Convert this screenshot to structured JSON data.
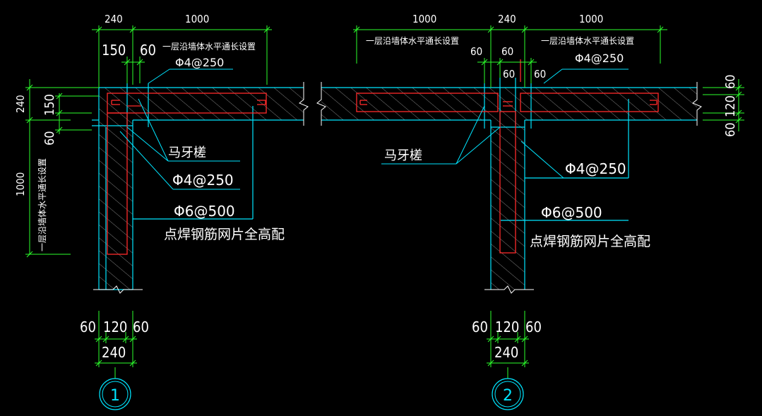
{
  "colors": {
    "background": "#000000",
    "wall_outline": "#00e5ff",
    "rebar": "#ff2a2a",
    "dimension": "#2cff2c",
    "text": "#ffffff",
    "hatch": "#a0a0a0"
  },
  "detail_1": {
    "number": "1",
    "dims_top": {
      "d240": "240",
      "d1000": "1000",
      "d150": "150",
      "d60": "60"
    },
    "note_top": "一层沿墙体水平通长设置",
    "rebar_top": "Φ4@250",
    "dims_left": {
      "d240": "240",
      "d150": "150",
      "d60": "60",
      "d1000": "1000"
    },
    "note_left": "一层沿墙体水平通长设置",
    "label_mayacha": "马牙槎",
    "label_rebar_a": "Φ4@250",
    "label_rebar_b": "Φ6@500",
    "label_mesh": "点焊钢筋网片全高配",
    "dims_bottom": {
      "d60a": "60",
      "d120": "120",
      "d60b": "60",
      "d240": "240"
    }
  },
  "detail_2": {
    "number": "2",
    "dims_top": {
      "d1000_left": "1000",
      "d240": "240",
      "d1000_right": "1000"
    },
    "note_top_left": "一层沿墙体水平通长设置",
    "note_top_right": "一层沿墙体水平通长设置",
    "rebar_top": "Φ4@250",
    "dims_center": {
      "d60_a": "60",
      "d60_b": "60",
      "d60_c": "60",
      "d60_d": "60"
    },
    "dims_right": {
      "d60_top": "60",
      "d120": "120",
      "d60_bottom": "60"
    },
    "label_mayacha": "马牙槎",
    "label_rebar_a": "Φ4@250",
    "label_rebar_b": "Φ6@500",
    "label_mesh": "点焊钢筋网片全高配",
    "dims_bottom": {
      "d60a": "60",
      "d120": "120",
      "d60b": "60",
      "d240": "240"
    }
  }
}
